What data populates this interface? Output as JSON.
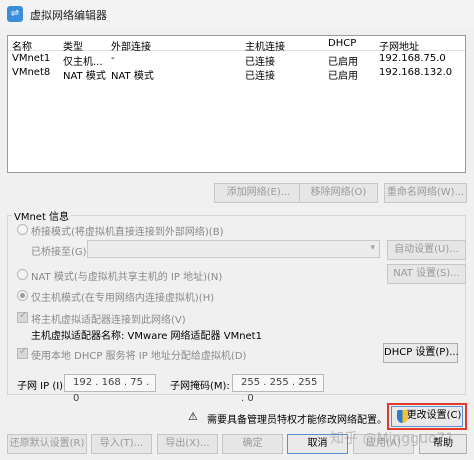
{
  "window": {
    "title": "虚拟网络编辑器"
  },
  "table": {
    "headers": [
      "名称",
      "类型",
      "外部连接",
      "主机连接",
      "DHCP",
      "子网地址"
    ],
    "rows": [
      [
        "VMnet1",
        "仅主机...",
        "-",
        "已连接",
        "已启用",
        "192.168.75.0"
      ],
      [
        "VMnet8",
        "NAT 模式",
        "NAT 模式",
        "已连接",
        "已启用",
        "192.168.132.0"
      ]
    ]
  },
  "net_buttons": {
    "add": "添加网络(E)...",
    "remove": "移除网络(O)",
    "rename": "重命名网络(W)..."
  },
  "info": {
    "title": "VMnet 信息",
    "bridged": "桥接模式(将虚拟机直接连接到外部网络)(B)",
    "bridged_to": "已桥接至(G):",
    "auto_settings": "自动设置(U)...",
    "nat": "NAT 模式(与虚拟机共享主机的 IP 地址)(N)",
    "nat_settings": "NAT 设置(S)...",
    "host_only": "仅主机模式(在专用网络内连接虚拟机)(H)",
    "connect_adapter": "将主机虚拟适配器连接到此网络(V)",
    "adapter_name": "主机虚拟适配器名称: VMware 网络适配器 VMnet1",
    "use_dhcp": "使用本地 DHCP 服务将 IP 地址分配给虚拟机(D)",
    "dhcp_settings": "DHCP 设置(P)...",
    "subnet_ip_label": "子网 IP (I):",
    "subnet_ip": "192 . 168 . 75 . 0",
    "subnet_mask_label": "子网掩码(M):",
    "subnet_mask": "255 . 255 . 255 . 0"
  },
  "admin": {
    "notice": "需要具备管理员特权才能修改网络配置。",
    "change": "更改设置(C)"
  },
  "footer": {
    "restore": "还原默认设置(R)",
    "import": "导入(T)...",
    "export": "导出(X)...",
    "ok": "确定",
    "cancel": "取消",
    "apply": "应用(A)",
    "help": "帮助"
  },
  "watermark": "知乎 @Mingguo71",
  "colors": {
    "highlight": "#e23a2a",
    "accent": "#3b8fd8"
  }
}
